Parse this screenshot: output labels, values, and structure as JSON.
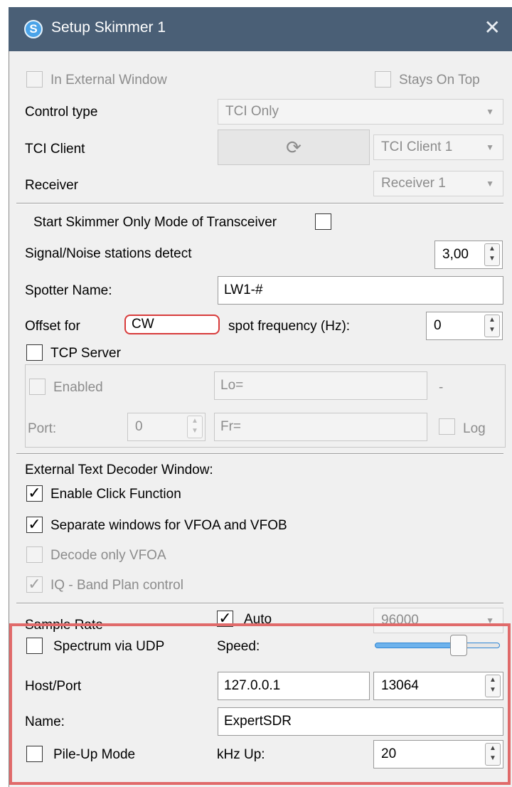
{
  "window": {
    "title": "Setup Skimmer 1",
    "close_glyph": "✕",
    "app_icon": "S"
  },
  "top": {
    "external_window": {
      "label": "In External Window",
      "checked": false,
      "enabled": false
    },
    "stays_on_top": {
      "label": "Stays On Top",
      "checked": false,
      "enabled": false
    },
    "control_type": {
      "label": "Control type",
      "value": "TCI Only"
    },
    "tci_client": {
      "label": "TCI Client",
      "refresh_glyph": "⟳",
      "value": "TCI Client 1"
    },
    "receiver": {
      "label": "Receiver",
      "value": "Receiver 1"
    }
  },
  "skimmer": {
    "skimmer_only_mode": {
      "label": "Start Skimmer Only Mode of Transceiver",
      "checked": false
    },
    "snr_detect": {
      "label": "Signal/Noise stations detect",
      "value": "3,00"
    },
    "spotter_name": {
      "label": "Spotter Name:",
      "value": "LW1-#"
    },
    "offset": {
      "label_prefix": "Offset for",
      "mode": "CW",
      "label_suffix": "spot frequency (Hz):",
      "value": "0"
    },
    "tcp_server": {
      "label": "TCP Server",
      "checked": false,
      "enabled": {
        "label": "Enabled",
        "checked": false
      },
      "lo_field": "Lo=",
      "dash": "-",
      "port_label": "Port:",
      "port_value": "0",
      "fr_field": "Fr=",
      "log": {
        "label": "Log",
        "checked": false
      }
    }
  },
  "decoder": {
    "heading": "External Text Decoder Window:",
    "enable_click": {
      "label": "Enable Click Function",
      "checked": true
    },
    "separate_windows": {
      "label": "Separate windows for VFOA and VFOB",
      "checked": true
    },
    "decode_only_vfoa": {
      "label": "Decode only VFOA",
      "checked": false,
      "enabled": false
    },
    "iq_band_plan": {
      "label": "IQ - Band Plan control",
      "checked": true,
      "enabled": false
    }
  },
  "sample": {
    "label": "Sample Rate",
    "auto": {
      "label": "Auto",
      "checked": true
    },
    "value": "96000"
  },
  "udp": {
    "spectrum": {
      "label": "Spectrum via UDP",
      "checked": false
    },
    "speed_label": "Speed:",
    "speed_level": 0.7,
    "host_port_label": "Host/Port",
    "host": "127.0.0.1",
    "port": "13064",
    "name_label": "Name:",
    "name": "ExpertSDR",
    "pileup": {
      "label": "Pile-Up Mode",
      "checked": false
    },
    "khz_up_label": "kHz Up:",
    "khz_up": "20"
  },
  "colors": {
    "titlebar": "#4a5f76",
    "highlight": "#e06a6a",
    "accent": "#2f86d4"
  },
  "icons": [
    "app-logo-icon",
    "close-icon",
    "refresh-icon",
    "dropdown-arrow-icon",
    "spin-arrows-icon",
    "checkmark-icon"
  ]
}
